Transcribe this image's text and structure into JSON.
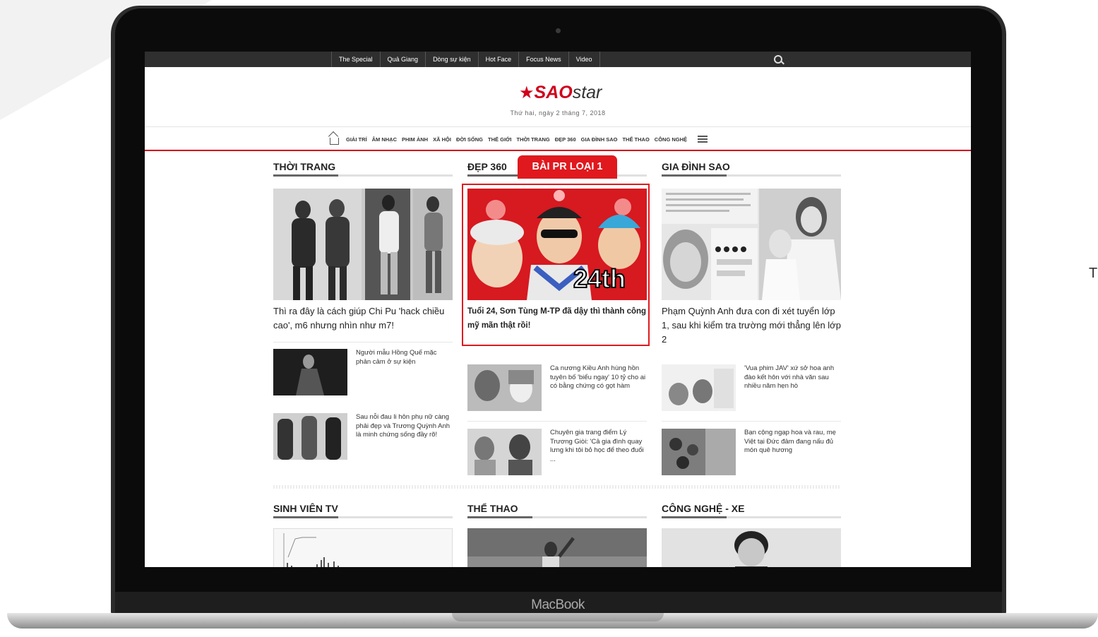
{
  "window": {
    "side_letter": "T",
    "device_label": "MacBook"
  },
  "topbar": {
    "links": [
      "The Special",
      "Quả Giang",
      "Dòng sự kiện",
      "Hot Face",
      "Focus News",
      "Video"
    ]
  },
  "logo": {
    "star": "★",
    "sao": "SAO",
    "star_text": "star"
  },
  "dateline": "Thứ hai, ngày 2 tháng 7, 2018",
  "nav": {
    "items": [
      "GIẢI TRÍ",
      "ÂM NHẠC",
      "PHIM ẢNH",
      "XÃ HỘI",
      "ĐỜI SỐNG",
      "THẾ GIỚI",
      "THỜI TRANG",
      "ĐẸP 360",
      "GIA ĐÌNH SAO",
      "THỂ THAO",
      "CÔNG NGHỆ"
    ]
  },
  "sections": [
    {
      "title": "THỜI TRANG",
      "main_title": "Thì ra đây là cách giúp Chi Pu 'hack chiều cao', m6 nhưng nhìn như m7!",
      "items": [
        "Người mẫu Hồng Quế mặc phản cảm ở sự kiện",
        "Sau nỗi đau li hôn phụ nữ càng phải đẹp và Trương Quỳnh Anh là minh chứng sống đầy rõ!"
      ]
    },
    {
      "title": "ĐẸP 360",
      "pr_tag": "BÀI PR LOẠI 1",
      "image_text": "24th",
      "main_title": "Tuổi 24, Sơn Tùng M-TP đã dậy thì thành công mỹ mãn thật rồi!",
      "items": [
        "Ca nương Kiều Anh hùng hồn tuyên bố 'biểu ngay' 10 tỷ cho ai có bằng chứng có gọt hàm",
        "Chuyên gia trang điểm Lý Trương Giòi: 'Cả gia đình quay lưng khi tôi bỏ học để theo đuổi ..."
      ]
    },
    {
      "title": "GIA ĐÌNH SAO",
      "main_title": "Phạm Quỳnh Anh đưa con đi xét tuyển lớp 1, sau khi kiểm tra trường mới thẳng lên lớp 2",
      "items": [
        "'Vua phim JAV' xứ sở hoa anh đào kết hôn với nhà văn sau nhiều năm hẹn hò",
        "Bạn cộng ngạp hoa và rau, mẹ Việt tại Đức đảm đang nấu đủ món quê hương"
      ]
    }
  ],
  "bottom_sections": [
    "SINH VIÊN TV",
    "THỂ THAO",
    "CÔNG NGHỆ - XE"
  ],
  "colors": {
    "accent": "#e0191e",
    "topbar": "#2f2f2f"
  }
}
